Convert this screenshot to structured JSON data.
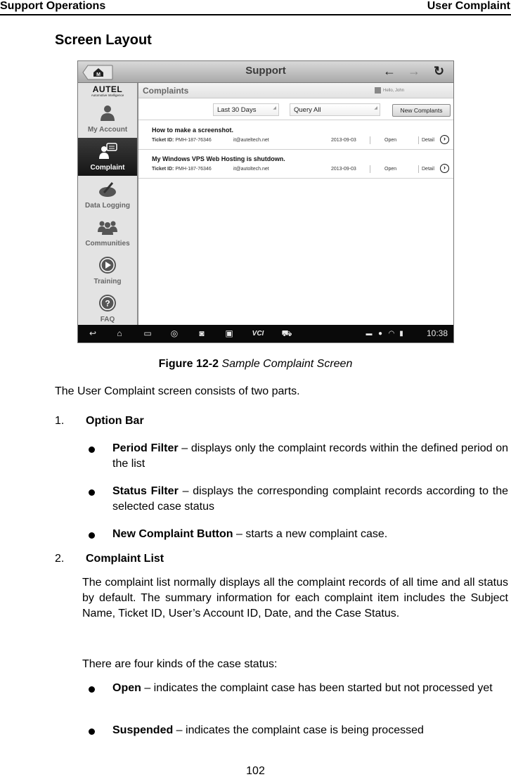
{
  "header": {
    "left": "Support Operations",
    "right": "User Complaint"
  },
  "section_title": "Screen Layout",
  "device": {
    "title": "Support",
    "home_label": "M",
    "nav": {
      "back": "←",
      "forward": "→",
      "refresh": "↻"
    },
    "brand": {
      "logo": "AUTEL",
      "tagline": "Automotive Intelligence"
    },
    "sidebar": [
      {
        "label": "My Account",
        "icon": "user-icon",
        "active": false
      },
      {
        "label": "Complaint",
        "icon": "complaint-icon",
        "active": true
      },
      {
        "label": "Data Logging",
        "icon": "data-logging-icon",
        "active": false
      },
      {
        "label": "Communities",
        "icon": "communities-icon",
        "active": false
      },
      {
        "label": "Training",
        "icon": "play-icon",
        "active": false
      },
      {
        "label": "FAQ",
        "icon": "question-icon",
        "active": false
      }
    ],
    "content_title": "Complaints",
    "greeting": "Hello, John",
    "period_filter": "Last 30 Days",
    "status_filter": "Query All",
    "new_button": "New Complants",
    "tickets": [
      {
        "subject": "How to make a screenshot.",
        "ticket_label": "Ticket ID:",
        "ticket_id": "PMH-187-76346",
        "email": "it@auteltech.net",
        "date": "2013-09-03",
        "status": "Open",
        "detail": "Detail"
      },
      {
        "subject": "My Windows VPS Web Hosting is shutdown.",
        "ticket_label": "Ticket ID:",
        "ticket_id": "PMH-187-76346",
        "email": "it@autoltech.net",
        "date": "2013-09-03",
        "status": "Open",
        "detail": "Detail"
      }
    ],
    "statusbar": {
      "icons": [
        "back-icon",
        "home-icon",
        "recent-apps-icon",
        "browser-icon",
        "camera-icon",
        "display-icon",
        "vci-icon",
        "car-icon"
      ],
      "vci_label": "VCI",
      "time": "10:38"
    }
  },
  "caption": {
    "label": "Figure 12-2",
    "text": "Sample Complaint Screen"
  },
  "intro": "The User Complaint screen consists of two parts.",
  "items": [
    {
      "num": "1.",
      "title": "Option Bar",
      "bullets": [
        {
          "term": "Period Filter",
          "desc": " – displays only the complaint records within the defined period on the list"
        },
        {
          "term": "Status Filter",
          "desc": " – displays the corresponding complaint records according to the selected case status"
        },
        {
          "term": "New Complaint Button",
          "desc": " – starts a new complaint case."
        }
      ]
    },
    {
      "num": "2.",
      "title": "Complaint List",
      "paragraph": "The complaint list normally displays all the complaint records of all time and all status by default. The summary information for each complaint item includes the Subject Name, Ticket ID, User’s Account ID, Date, and the Case Status.",
      "status_intro": "There are four kinds of the case status:",
      "bullets": [
        {
          "term": "Open",
          "desc": " – indicates the complaint case has been started but not processed yet"
        },
        {
          "term": "Suspended",
          "desc": " – indicates the complaint case is being processed"
        }
      ]
    }
  ],
  "page_number": "102"
}
